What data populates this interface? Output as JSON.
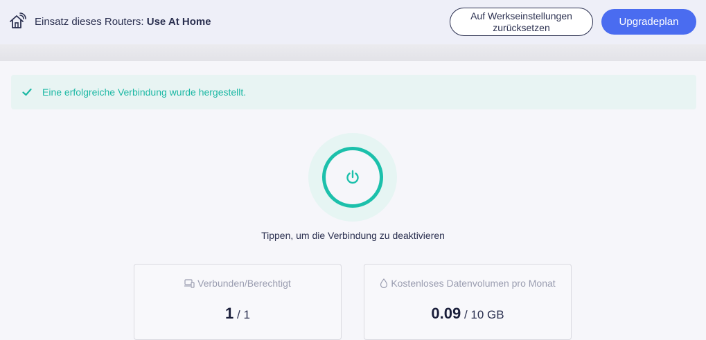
{
  "header": {
    "usage_prefix": "Einsatz dieses Routers:",
    "usage_value": "Use At Home",
    "reset_label": "Auf Werkseinstellungen zurücksetzen",
    "upgrade_label": "Upgradeplan",
    "icon": "home-wifi-icon"
  },
  "alert": {
    "icon": "check-icon",
    "message": "Eine erfolgreiche Verbindung wurde hergestellt.",
    "color": "#1cb8a4"
  },
  "power": {
    "icon": "power-icon",
    "hint": "Tippen, um die Verbindung zu deaktivieren",
    "color": "#1cc0ab"
  },
  "stats": {
    "devices": {
      "icon": "devices-icon",
      "label": "Verbunden/Berechtigt",
      "current": "1",
      "separator": "/",
      "max": "1"
    },
    "data": {
      "icon": "drop-icon",
      "label": "Kostenloses Datenvolumen pro Monat",
      "used": "0.09",
      "separator": "/",
      "total": "10 GB"
    }
  },
  "colors": {
    "accent": "#4a6cf0",
    "success": "#1cb8a4",
    "text": "#2a2f4f"
  }
}
